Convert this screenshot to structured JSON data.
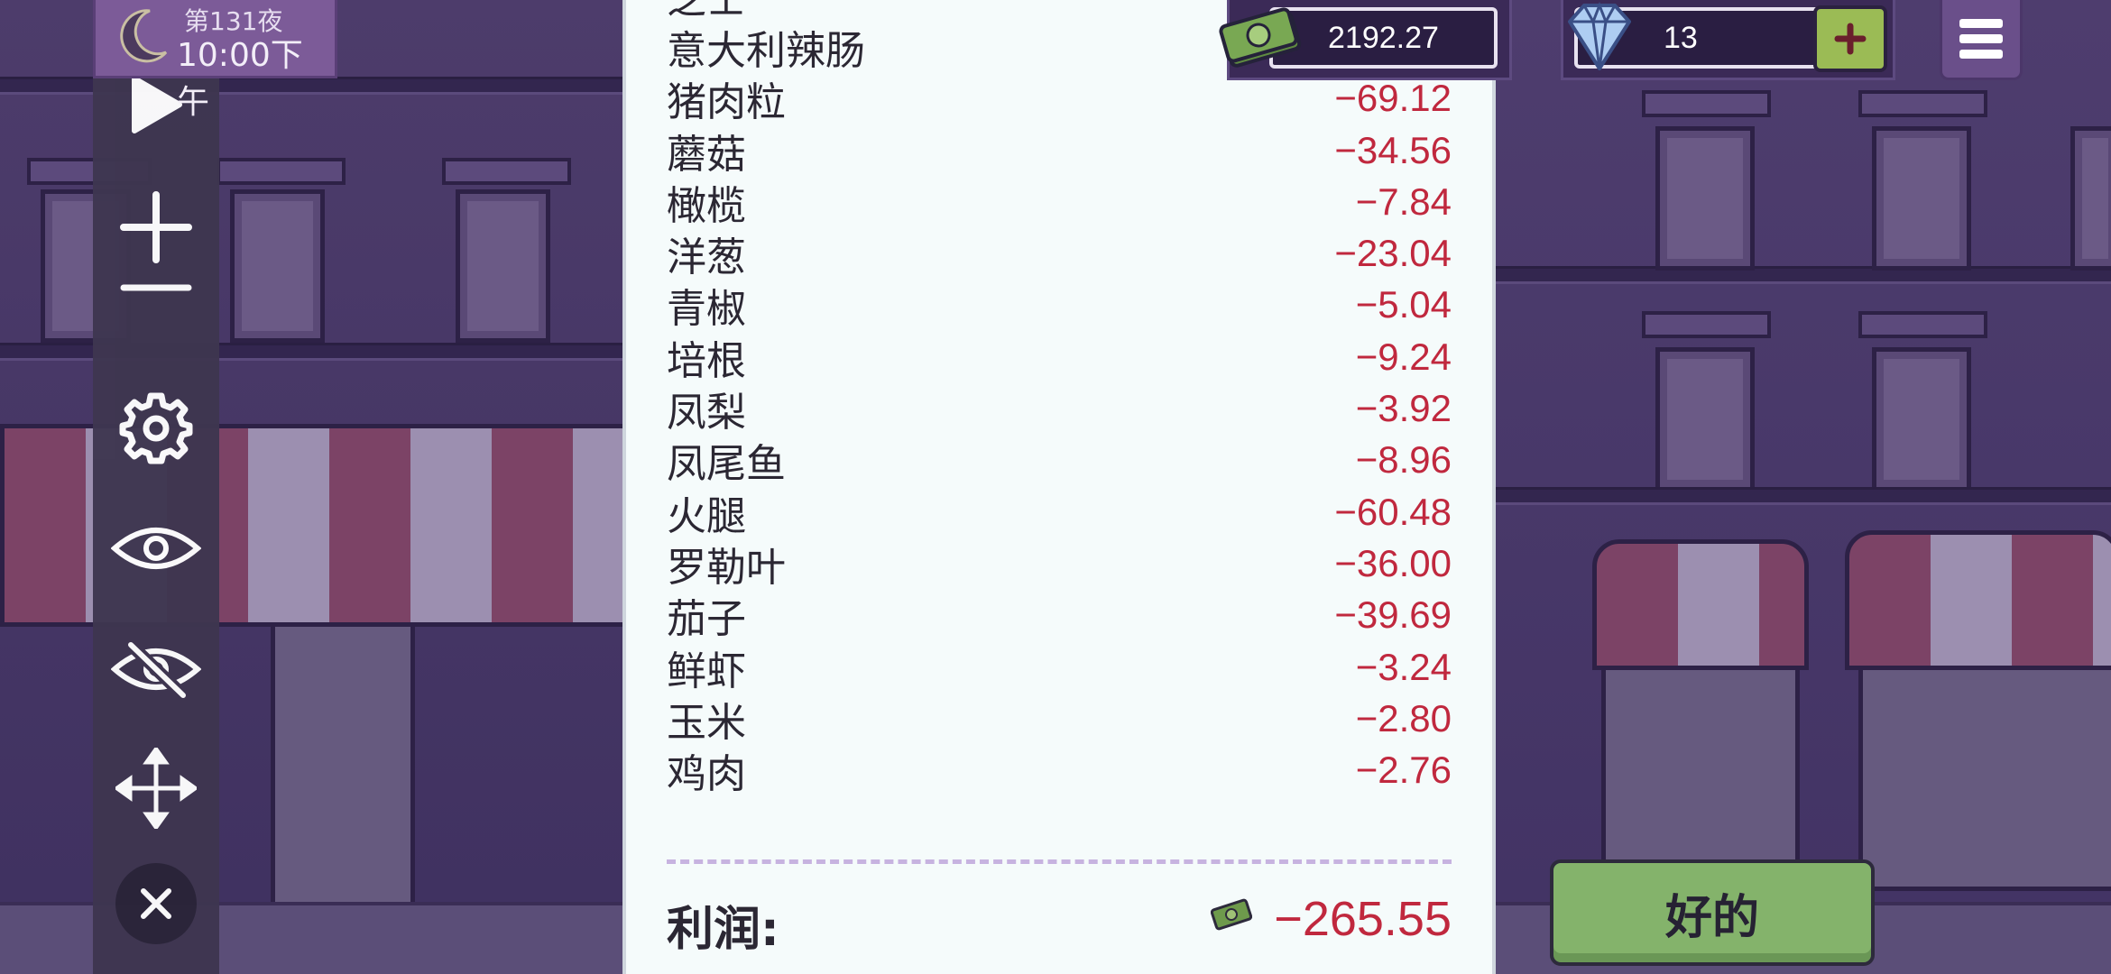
{
  "hud": {
    "day": "第131夜",
    "time": "10:00下午",
    "money": "2192.27",
    "gems": "13"
  },
  "receipt": {
    "items": [
      {
        "name": "芝士",
        "amount": ""
      },
      {
        "name": "意大利辣肠",
        "amount": ""
      },
      {
        "name": "猪肉粒",
        "amount": "−69.12"
      },
      {
        "name": "蘑菇",
        "amount": "−34.56"
      },
      {
        "name": "橄榄",
        "amount": "−7.84"
      },
      {
        "name": "洋葱",
        "amount": "−23.04"
      },
      {
        "name": "青椒",
        "amount": "−5.04"
      },
      {
        "name": "培根",
        "amount": "−9.24"
      },
      {
        "name": "凤梨",
        "amount": "−3.92"
      },
      {
        "name": "凤尾鱼",
        "amount": "−8.96"
      },
      {
        "name": "火腿",
        "amount": "−60.48"
      },
      {
        "name": "罗勒叶",
        "amount": "−36.00"
      },
      {
        "name": "茄子",
        "amount": "−39.69"
      },
      {
        "name": "鲜虾",
        "amount": "−3.24"
      },
      {
        "name": "玉米",
        "amount": "−2.80"
      },
      {
        "name": "鸡肉",
        "amount": "−2.76"
      }
    ],
    "profit_label": "利润:",
    "profit_value": "−265.55"
  },
  "buttons": {
    "ok": "好的"
  },
  "toolbar": {
    "icons": [
      "play-icon",
      "zoom-in-icon",
      "zoom-out-icon",
      "gear-icon",
      "eye-icon",
      "eye-off-icon",
      "move-icon",
      "close-icon"
    ]
  },
  "colors": {
    "negative": "#c0283e",
    "ok_button": "#84b36b",
    "gem_plus": "#9bbb55"
  }
}
